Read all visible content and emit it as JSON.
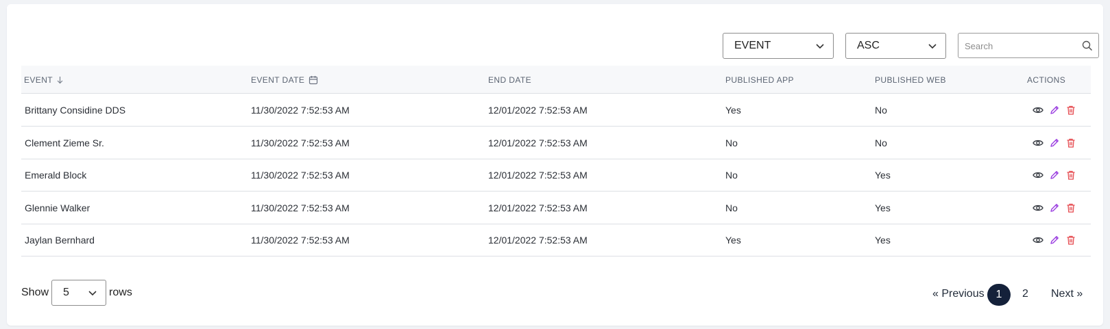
{
  "toolbar": {
    "sort_field": {
      "value": "EVENT",
      "icon": "chevron-down-icon"
    },
    "sort_order": {
      "value": "ASC",
      "icon": "chevron-down-icon"
    },
    "search": {
      "placeholder": "Search",
      "value": "",
      "icon": "search-icon"
    }
  },
  "table": {
    "columns": [
      {
        "label": "EVENT",
        "icon": "arrow-down-icon"
      },
      {
        "label": "EVENT DATE",
        "icon": "calendar-icon"
      },
      {
        "label": "END DATE"
      },
      {
        "label": "PUBLISHED APP"
      },
      {
        "label": "PUBLISHED WEB"
      },
      {
        "label": "ACTIONS"
      }
    ],
    "rows": [
      {
        "event": "Brittany Considine DDS",
        "event_date": "11/30/2022 7:52:53 AM",
        "end_date": "12/01/2022 7:52:53 AM",
        "published_app": "Yes",
        "published_web": "No"
      },
      {
        "event": "Clement Zieme Sr.",
        "event_date": "11/30/2022 7:52:53 AM",
        "end_date": "12/01/2022 7:52:53 AM",
        "published_app": "No",
        "published_web": "No"
      },
      {
        "event": "Emerald Block",
        "event_date": "11/30/2022 7:52:53 AM",
        "end_date": "12/01/2022 7:52:53 AM",
        "published_app": "No",
        "published_web": "Yes"
      },
      {
        "event": "Glennie Walker",
        "event_date": "11/30/2022 7:52:53 AM",
        "end_date": "12/01/2022 7:52:53 AM",
        "published_app": "No",
        "published_web": "Yes"
      },
      {
        "event": "Jaylan Bernhard",
        "event_date": "11/30/2022 7:52:53 AM",
        "end_date": "12/01/2022 7:52:53 AM",
        "published_app": "Yes",
        "published_web": "Yes"
      }
    ],
    "action_icons": [
      "eye-icon",
      "pencil-icon",
      "trash-icon"
    ]
  },
  "footer": {
    "show_label": "Show",
    "rows_value": "5",
    "rows_label": "rows",
    "pagination": {
      "previous": "« Previous",
      "pages": [
        "1",
        "2"
      ],
      "current": "1",
      "next": "Next »"
    }
  },
  "colors": {
    "view_icon": "#3b3f46",
    "edit_icon": "#9b3fe0",
    "delete_icon": "#e5484d",
    "active_page": "#14213a"
  }
}
